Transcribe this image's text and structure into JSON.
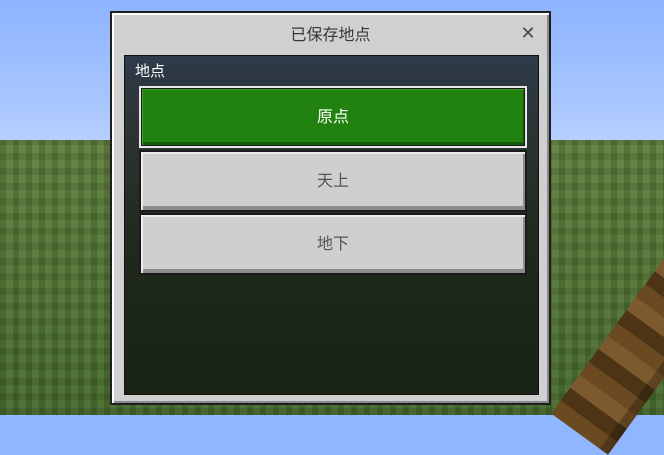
{
  "dialog": {
    "title": "已保存地点",
    "close_glyph": "✕",
    "section_label": "地点",
    "locations": [
      {
        "label": "原点",
        "selected": true
      },
      {
        "label": "天上",
        "selected": false
      },
      {
        "label": "地下",
        "selected": false
      }
    ]
  },
  "colors": {
    "selected_button": "#21820f",
    "button": "#cfcfcf",
    "dialog": "#d0d0d0"
  }
}
